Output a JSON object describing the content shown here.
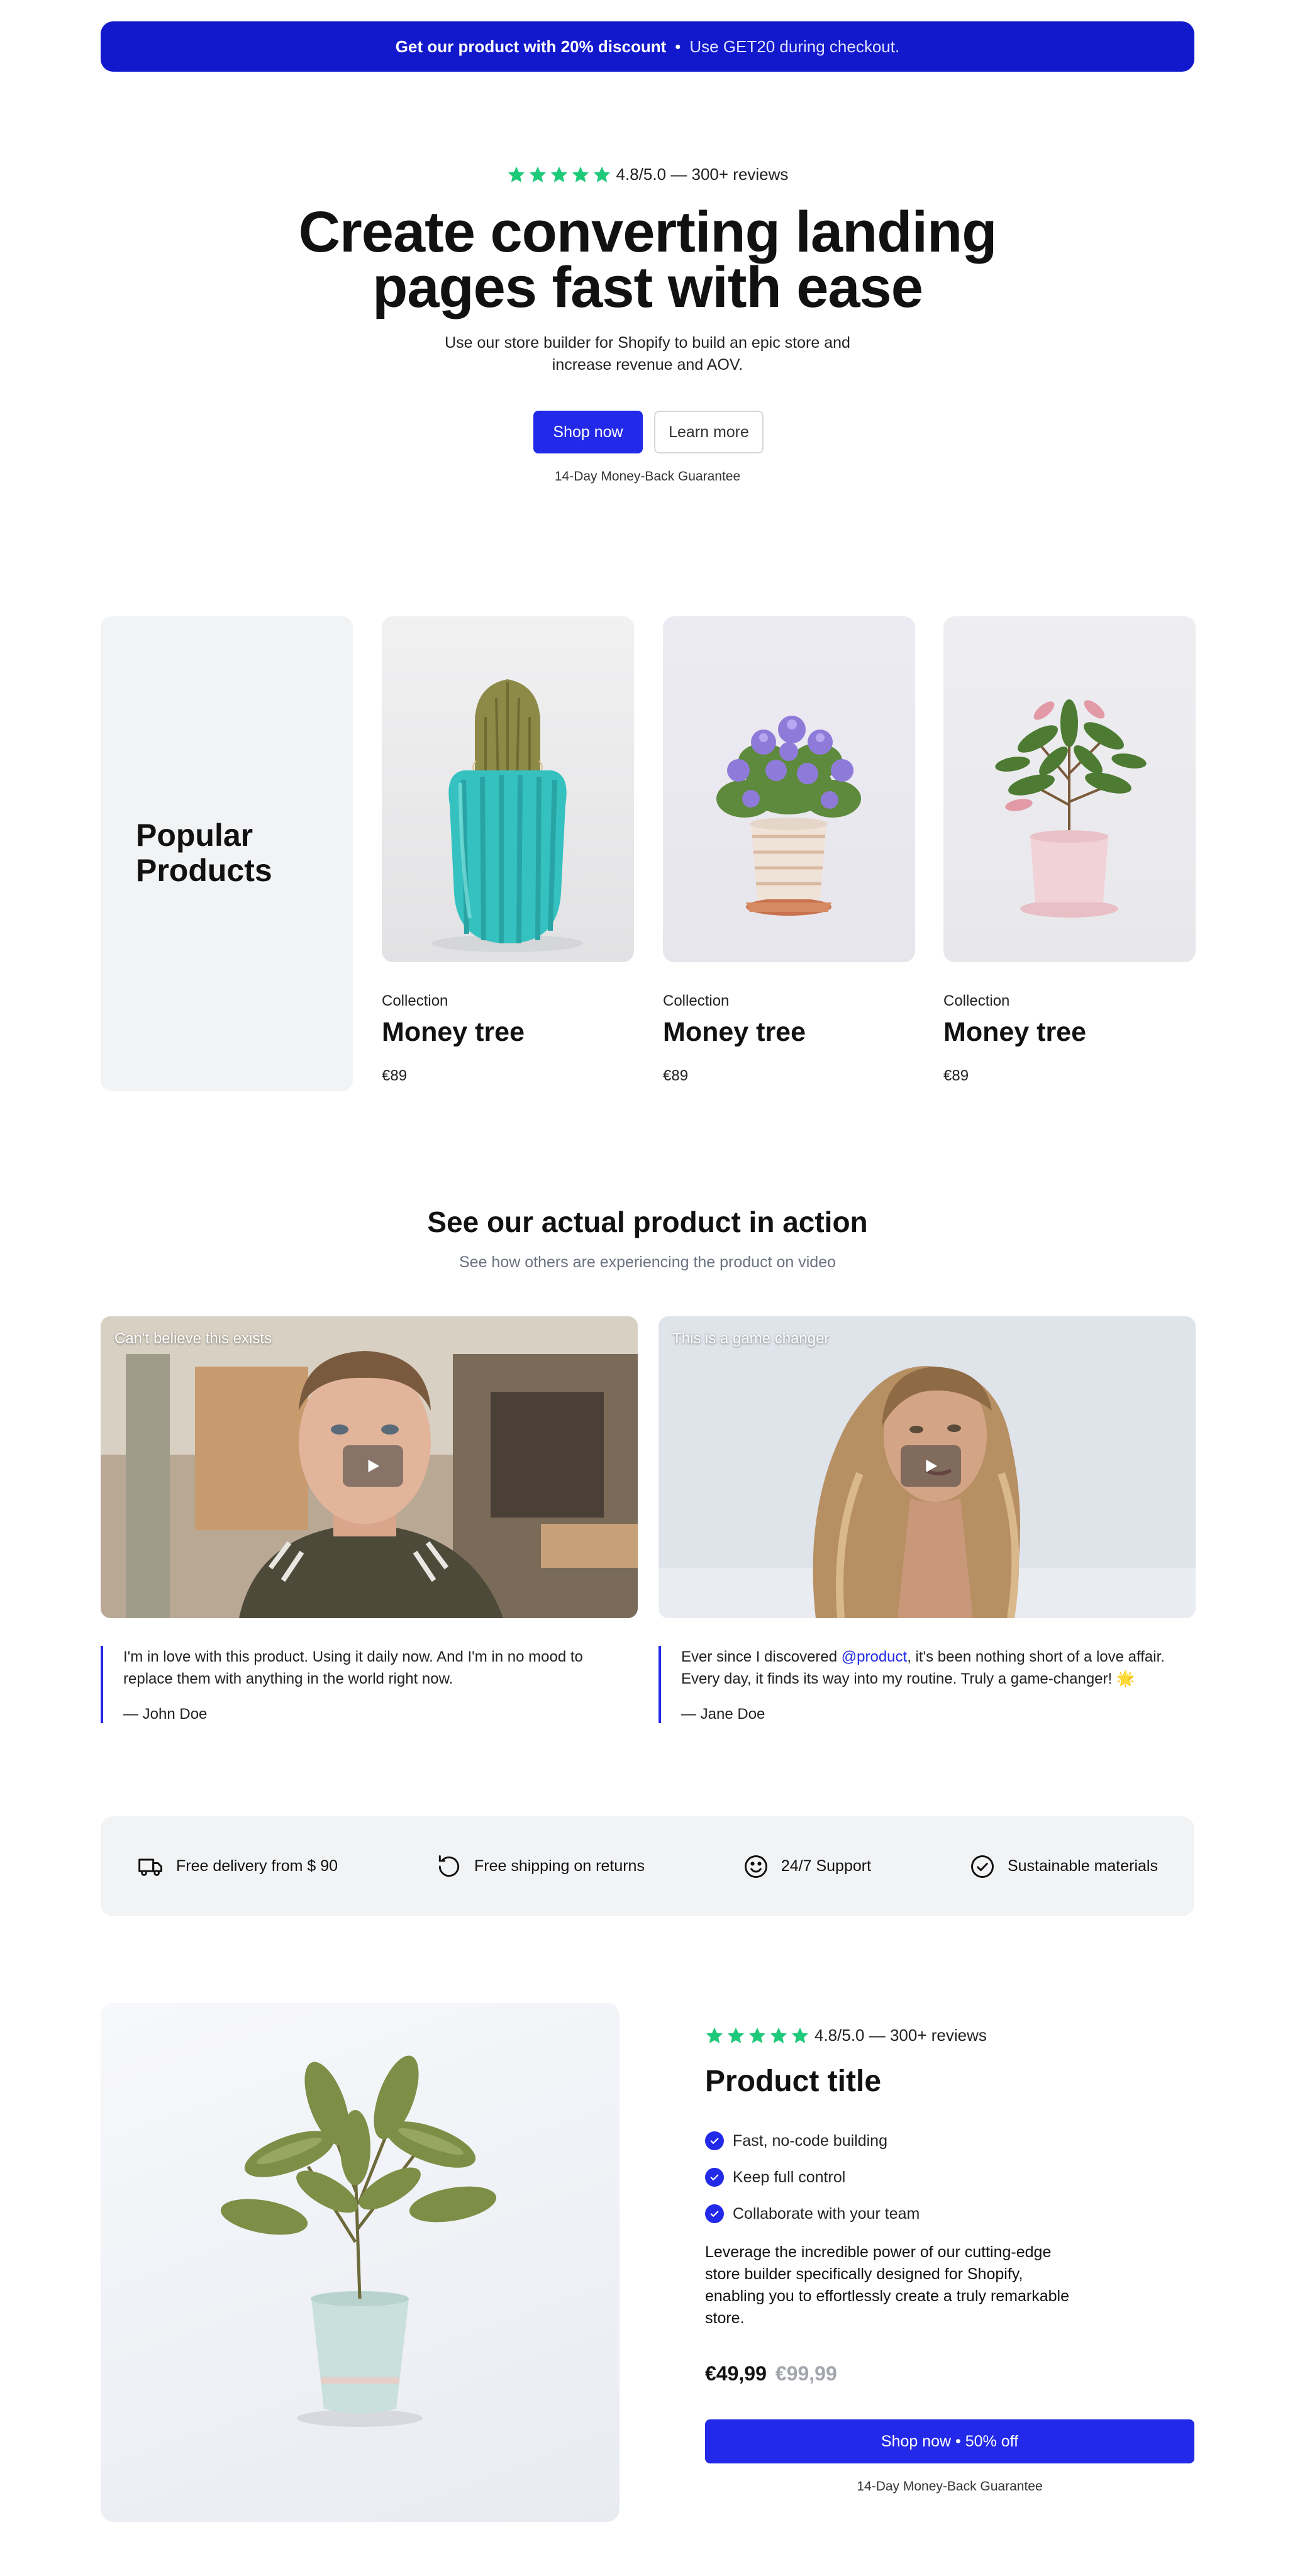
{
  "announcement": {
    "bold_text": "Get our product with 20% discount",
    "separator": "•",
    "text": "Use GET20 during checkout."
  },
  "hero": {
    "rating_text": "4.8/5.0 — 300+ reviews",
    "title_line1": "Create converting landing",
    "title_line2": "pages fast with ease",
    "subtitle_line1": "Use our store builder for Shopify to build an epic store and",
    "subtitle_line2": "increase revenue and AOV.",
    "primary_button": "Shop now",
    "secondary_button": "Learn more",
    "guarantee": "14-Day Money-Back Guarantee"
  },
  "popular": {
    "title_line1": "Popular",
    "title_line2": "Products",
    "products": [
      {
        "collection": "Collection",
        "name": "Money tree",
        "price": "€89",
        "image": "cactus-in-teal-pot"
      },
      {
        "collection": "Collection",
        "name": "Money tree",
        "price": "€89",
        "image": "purple-flowers-in-white-pot"
      },
      {
        "collection": "Collection",
        "name": "Money tree",
        "price": "€89",
        "image": "leafy-plant-in-pink-pot"
      }
    ]
  },
  "videos": {
    "title": "See our actual product in action",
    "subtitle": "See how others are experiencing the product on video",
    "items": [
      {
        "caption": "Can't believe this exists",
        "quote_line1": "I'm in love with this product. Using it daily now. And I'm in no mood to",
        "quote_line2": "replace them with anything in the world right now.",
        "author": "— John Doe"
      },
      {
        "caption": "This is a game changer",
        "quote_pre": "Ever since I discovered ",
        "quote_mention": "@product",
        "quote_post": ", it's been nothing short of a love affair.",
        "quote_line2": "Every day, it finds its way into my routine. Truly a game-changer! 🌟",
        "author": "— Jane Doe"
      }
    ]
  },
  "features": [
    {
      "icon": "truck-icon",
      "label": "Free delivery from $ 90"
    },
    {
      "icon": "return-arrow-icon",
      "label": "Free shipping on returns"
    },
    {
      "icon": "smile-icon",
      "label": "24/7 Support"
    },
    {
      "icon": "check-circle-icon",
      "label": "Sustainable materials"
    }
  ],
  "product": {
    "rating_text": "4.8/5.0 — 300+ reviews",
    "title": "Product title",
    "benefits": [
      "Fast, no-code building",
      "Keep full control",
      "Collaborate with your team"
    ],
    "description_lines": [
      "Leverage the incredible power of our cutting-edge",
      "store builder specifically designed for Shopify,",
      "enabling you to effortlessly create a truly remarkable",
      "store."
    ],
    "price": "€49,99",
    "compare_price": "€99,99",
    "button": "Shop now • 50% off",
    "guarantee": "14-Day Money-Back Guarantee"
  },
  "colors": {
    "brand_blue": "#2229e8",
    "announce_blue": "#1219cc",
    "star_green": "#1ec97a",
    "panel_gray": "#f2f3f5"
  }
}
